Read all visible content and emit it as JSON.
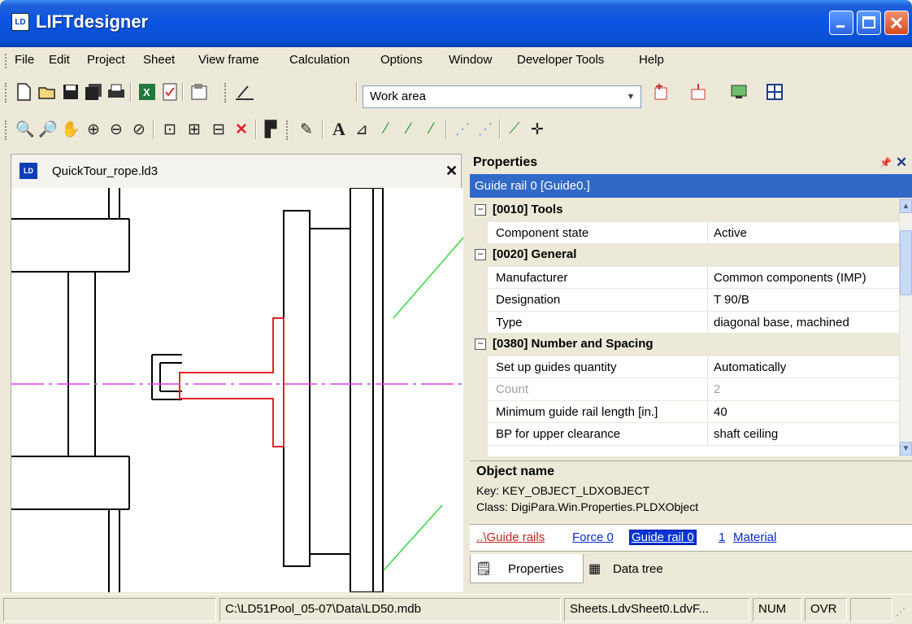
{
  "window": {
    "title": "LIFTdesigner",
    "icon": "LD-app-icon"
  },
  "menu": [
    {
      "label": "File"
    },
    {
      "label": "Edit"
    },
    {
      "label": "Project"
    },
    {
      "label": "Sheet"
    },
    {
      "label": "View frame"
    },
    {
      "label": "Calculation"
    },
    {
      "label": "Options"
    },
    {
      "label": "Window"
    },
    {
      "label": "Developer Tools"
    },
    {
      "label": "Help"
    }
  ],
  "toolbar1": {
    "combo_value": "Work area"
  },
  "document": {
    "tab_label": "QuickTour_rope.ld3"
  },
  "properties": {
    "title": "Properties",
    "selected_object": "Guide rail 0 [Guide0.]",
    "rows": [
      {
        "kind": "category",
        "label": "[0010] Tools"
      },
      {
        "kind": "prop",
        "name": "Component state",
        "value": "Active"
      },
      {
        "kind": "category",
        "label": "[0020] General"
      },
      {
        "kind": "prop",
        "name": "Manufacturer",
        "value": "Common components (IMP)"
      },
      {
        "kind": "prop",
        "name": "Designation",
        "value": "T 90/B"
      },
      {
        "kind": "prop",
        "name": "Type",
        "value": "diagonal base, machined"
      },
      {
        "kind": "category",
        "label": "[0380] Number and Spacing"
      },
      {
        "kind": "prop",
        "name": "Set up guides quantity",
        "value": "Automatically"
      },
      {
        "kind": "prop",
        "name": "Count",
        "value": "2",
        "disabled": true
      },
      {
        "kind": "prop",
        "name": "Minimum guide rail length [in.]",
        "value": "40"
      },
      {
        "kind": "prop",
        "name": "BP for upper clearance",
        "value": "shaft ceiling"
      }
    ],
    "description": {
      "title": "Object name",
      "key": "Key: KEY_OBJECT_LDXOBJECT",
      "class": "Class:  DigiPara.Win.Properties.PLDXObject"
    },
    "breadcrumbs": [
      {
        "label": "..\\Guide rails",
        "style": "red"
      },
      {
        "label": "Force 0",
        "style": "link"
      },
      {
        "label": "Guide rail 0",
        "style": "active"
      },
      {
        "label": "1",
        "style": "link"
      },
      {
        "label": "Material",
        "style": "link"
      }
    ],
    "tabs": [
      {
        "label": "Properties",
        "icon": "properties-icon"
      },
      {
        "label": "Data tree",
        "icon": "data-tree-icon"
      }
    ]
  },
  "statusbar": {
    "panel1": "",
    "path": "C:\\LD51Pool_05-07\\Data\\LD50.mdb",
    "sheet": "Sheets.LdvSheet0.LdvF...",
    "num": "NUM",
    "ovr": "OVR",
    "panel6": ""
  },
  "colors": {
    "selection": "#3169c6",
    "titlebar": "#0a54e3",
    "guide_red": "#e0242a",
    "axis_magenta": "#e23ce6",
    "diag_green": "#2fd93c"
  }
}
